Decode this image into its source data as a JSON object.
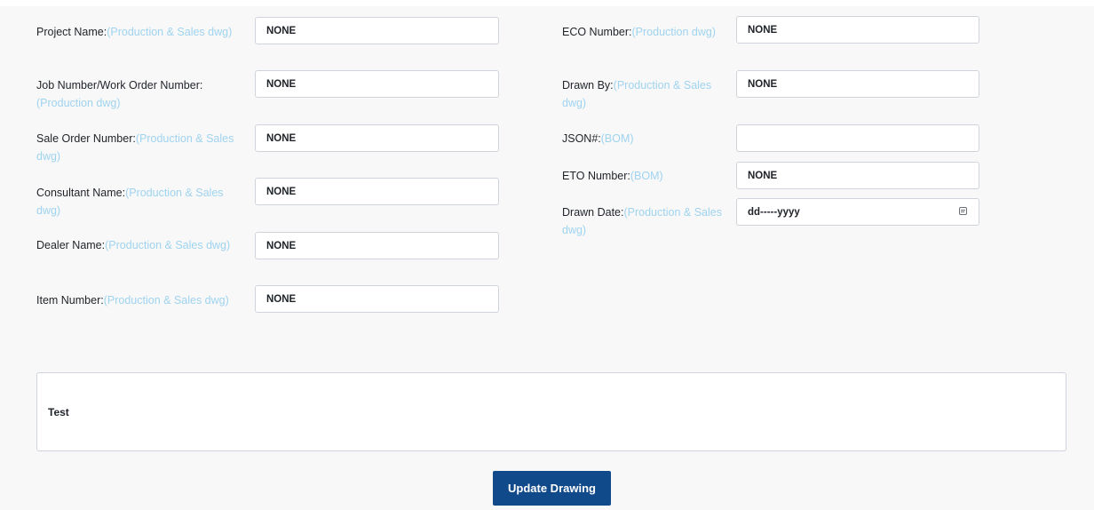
{
  "left_fields": [
    {
      "label": "Project Name:",
      "hint": "(Production & Sales dwg)",
      "value": "NONE"
    },
    {
      "label": "Job Number/Work Order Number:",
      "hint": "(Production dwg)",
      "value": "NONE"
    },
    {
      "label": "Sale Order Number:",
      "hint": "(Production & Sales dwg)",
      "value": "NONE"
    },
    {
      "label": "Consultant Name:",
      "hint": "(Production & Sales dwg)",
      "value": "NONE"
    },
    {
      "label": "Dealer Name:",
      "hint": "(Production & Sales dwg)",
      "value": "NONE"
    },
    {
      "label": "Item Number:",
      "hint": "(Production & Sales dwg)",
      "value": "NONE"
    }
  ],
  "right_fields": [
    {
      "label": "ECO Number:",
      "hint": "(Production dwg)",
      "value": "NONE"
    },
    {
      "label": "Drawn By:",
      "hint": "(Production & Sales dwg)",
      "value": "NONE"
    },
    {
      "label": "JSON#:",
      "hint": "(BOM)",
      "value": ""
    },
    {
      "label": "ETO Number:",
      "hint": "(BOM)",
      "value": "NONE"
    },
    {
      "label": "Drawn Date:",
      "hint": "(Production & Sales dwg)",
      "value": "dd-----yyyy",
      "icon": "calendar-icon"
    }
  ],
  "notes": {
    "value": "Test"
  },
  "submit": {
    "label": "Update Drawing"
  }
}
